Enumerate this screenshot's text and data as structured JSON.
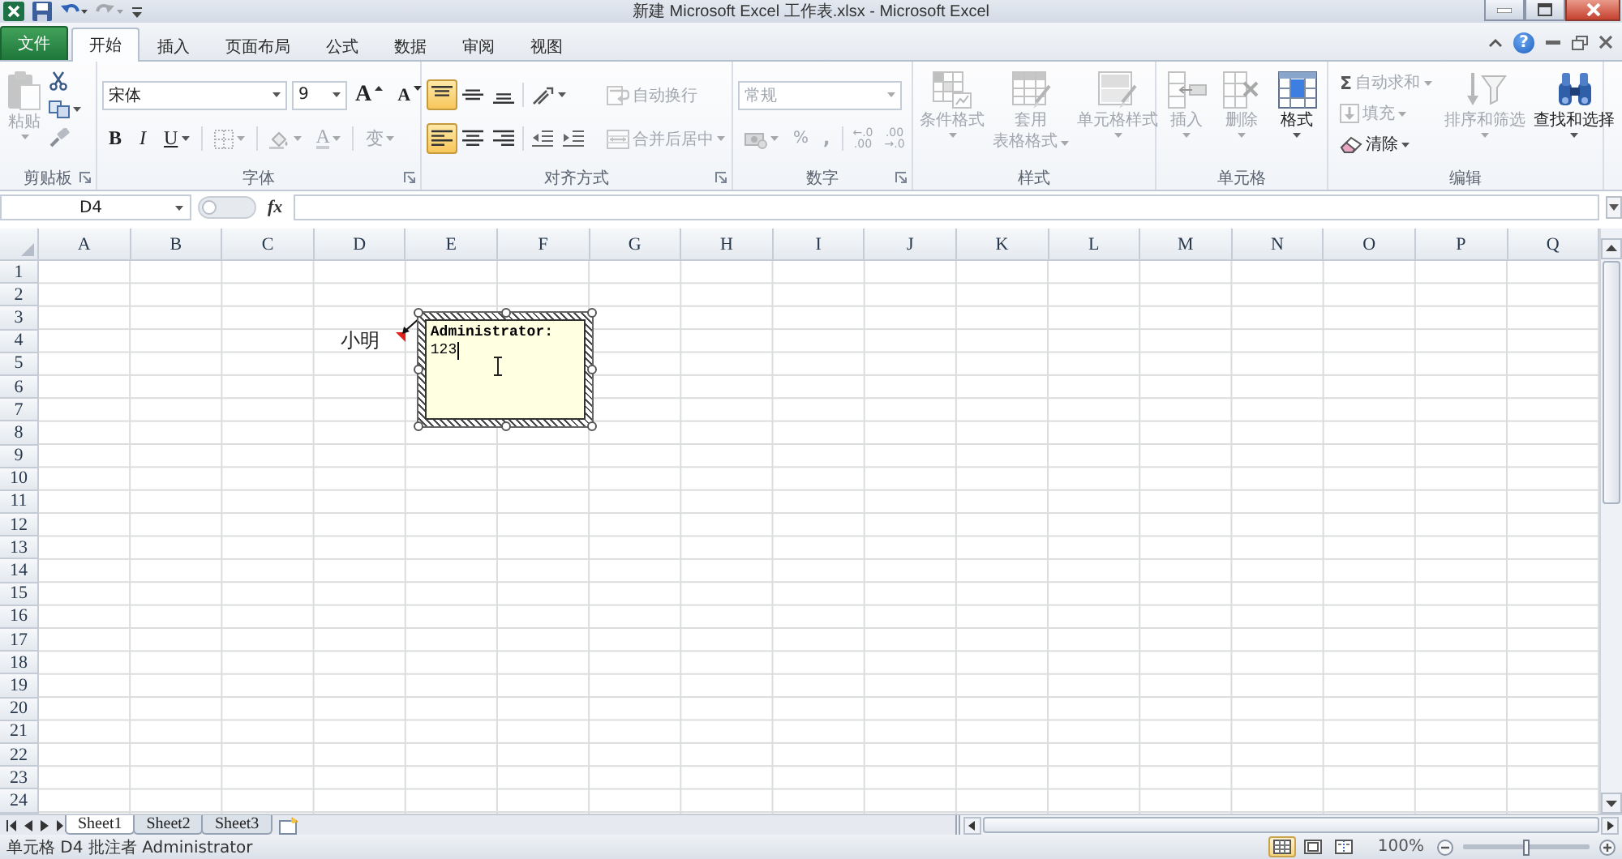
{
  "window": {
    "title": "新建 Microsoft Excel 工作表.xlsx - Microsoft Excel"
  },
  "quick_access": [
    {
      "kind": "save",
      "disabled": false
    },
    {
      "kind": "undo",
      "disabled": false
    },
    {
      "kind": "redo",
      "disabled": true
    }
  ],
  "tabs": [
    {
      "label": "文件",
      "kind": "file",
      "selected": false
    },
    {
      "label": "开始",
      "kind": "tab",
      "selected": true
    },
    {
      "label": "插入",
      "kind": "tab",
      "selected": false
    },
    {
      "label": "页面布局",
      "kind": "tab",
      "selected": false
    },
    {
      "label": "公式",
      "kind": "tab",
      "selected": false
    },
    {
      "label": "数据",
      "kind": "tab",
      "selected": false
    },
    {
      "label": "审阅",
      "kind": "tab",
      "selected": false
    },
    {
      "label": "视图",
      "kind": "tab",
      "selected": false
    }
  ],
  "help": {
    "label": "?"
  },
  "ribbon": {
    "clipboard": {
      "label": "剪贴板",
      "paste": {
        "label": "粘贴",
        "disabled": true
      }
    },
    "font": {
      "label": "字体",
      "font_name": "宋体",
      "font_size": "9",
      "size_buttons": [
        {
          "kind": "grow",
          "label": "A"
        },
        {
          "kind": "shrink",
          "label": "A"
        }
      ],
      "tools": [
        {
          "kind": "bold",
          "label": "B",
          "disabled": false
        },
        {
          "kind": "italic",
          "label": "I",
          "disabled": false
        },
        {
          "kind": "underline",
          "label": "U",
          "disabled": false
        },
        {
          "kind": "borders",
          "disabled": true
        },
        {
          "kind": "fill_color",
          "disabled": true
        },
        {
          "kind": "font_color",
          "label": "A",
          "disabled": true
        },
        {
          "kind": "phonetic",
          "label": "变",
          "disabled": true
        }
      ]
    },
    "alignment": {
      "label": "对齐方式",
      "vertical": [
        {
          "kind": "top",
          "selected": true
        },
        {
          "kind": "middle",
          "selected": false
        },
        {
          "kind": "bottom",
          "selected": false
        }
      ],
      "horizontal": [
        {
          "kind": "left",
          "selected": true
        },
        {
          "kind": "center",
          "selected": false
        },
        {
          "kind": "right",
          "selected": false
        }
      ],
      "wrap_text": {
        "label": "自动换行",
        "disabled": true
      },
      "merge_center": {
        "label": "合并后居中",
        "disabled": true
      }
    },
    "number": {
      "label": "数字",
      "format": {
        "value": "常规",
        "disabled": true
      },
      "tools": [
        {
          "kind": "currency",
          "disabled": true
        },
        {
          "kind": "percent",
          "label": "%",
          "disabled": true
        },
        {
          "kind": "comma",
          "label": ",",
          "disabled": true
        },
        {
          "kind": "increase_decimal",
          "lines": [
            "←.0",
            ".00"
          ],
          "disabled": true
        },
        {
          "kind": "decrease_decimal",
          "lines": [
            ".00",
            "→.0"
          ],
          "disabled": true
        }
      ]
    },
    "styles": {
      "label": "样式",
      "buttons": [
        {
          "kind": "conditional_format",
          "lines": [
            "条件格式"
          ],
          "disabled": true
        },
        {
          "kind": "format_as_table",
          "lines": [
            "套用",
            "表格格式"
          ],
          "disabled": true
        },
        {
          "kind": "cell_styles",
          "lines": [
            "单元格样式"
          ],
          "disabled": true
        }
      ]
    },
    "cells": {
      "label": "单元格",
      "buttons": [
        {
          "kind": "insert",
          "label": "插入",
          "disabled": true
        },
        {
          "kind": "delete",
          "label": "删除",
          "disabled": true
        },
        {
          "kind": "format",
          "label": "格式",
          "disabled": false
        }
      ]
    },
    "editing": {
      "label": "编辑",
      "small": [
        {
          "kind": "autosum",
          "symbol": "Σ",
          "label": "自动求和",
          "disabled": true
        },
        {
          "kind": "fill",
          "label": "填充",
          "disabled": true
        },
        {
          "kind": "clear",
          "label": "清除",
          "disabled": false
        }
      ],
      "big": [
        {
          "kind": "sort_filter",
          "label": "排序和筛选",
          "disabled": true
        },
        {
          "kind": "find_select",
          "label": "查找和选择",
          "disabled": false
        }
      ]
    }
  },
  "formula_bar": {
    "name_box": "D4",
    "function_label": "fx"
  },
  "sheet": {
    "columns": [
      "A",
      "B",
      "C",
      "D",
      "E",
      "F",
      "G",
      "H",
      "I",
      "J",
      "K",
      "L",
      "M",
      "N",
      "O",
      "P",
      "Q"
    ],
    "rows": [
      {
        "header": "1"
      },
      {
        "header": "2"
      },
      {
        "header": "3"
      },
      {
        "header": "4",
        "cells": [
          null,
          null,
          null,
          {
            "text": "小明",
            "has_comment": true
          }
        ]
      },
      {
        "header": "5"
      },
      {
        "header": "6"
      },
      {
        "header": "7"
      },
      {
        "header": "8"
      },
      {
        "header": "9"
      },
      {
        "header": "10"
      },
      {
        "header": "11"
      },
      {
        "header": "12"
      },
      {
        "header": "13"
      },
      {
        "header": "14"
      },
      {
        "header": "15"
      },
      {
        "header": "16"
      },
      {
        "header": "17"
      },
      {
        "header": "18"
      },
      {
        "header": "19"
      },
      {
        "header": "20"
      },
      {
        "header": "21"
      },
      {
        "header": "22"
      },
      {
        "header": "23"
      },
      {
        "header": "24"
      }
    ],
    "comment": {
      "author": "Administrator:",
      "text": "123"
    }
  },
  "sheet_tabs": [
    {
      "label": "Sheet1",
      "selected": true
    },
    {
      "label": "Sheet2",
      "selected": false
    },
    {
      "label": "Sheet3",
      "selected": false
    }
  ],
  "status_bar": {
    "text": "单元格 D4 批注者 Administrator",
    "views": [
      {
        "kind": "normal",
        "selected": true
      },
      {
        "kind": "page_layout",
        "selected": false
      },
      {
        "kind": "page_break",
        "selected": false
      }
    ],
    "zoom": "100%",
    "zoom_slider": {
      "level": 0.5
    }
  }
}
